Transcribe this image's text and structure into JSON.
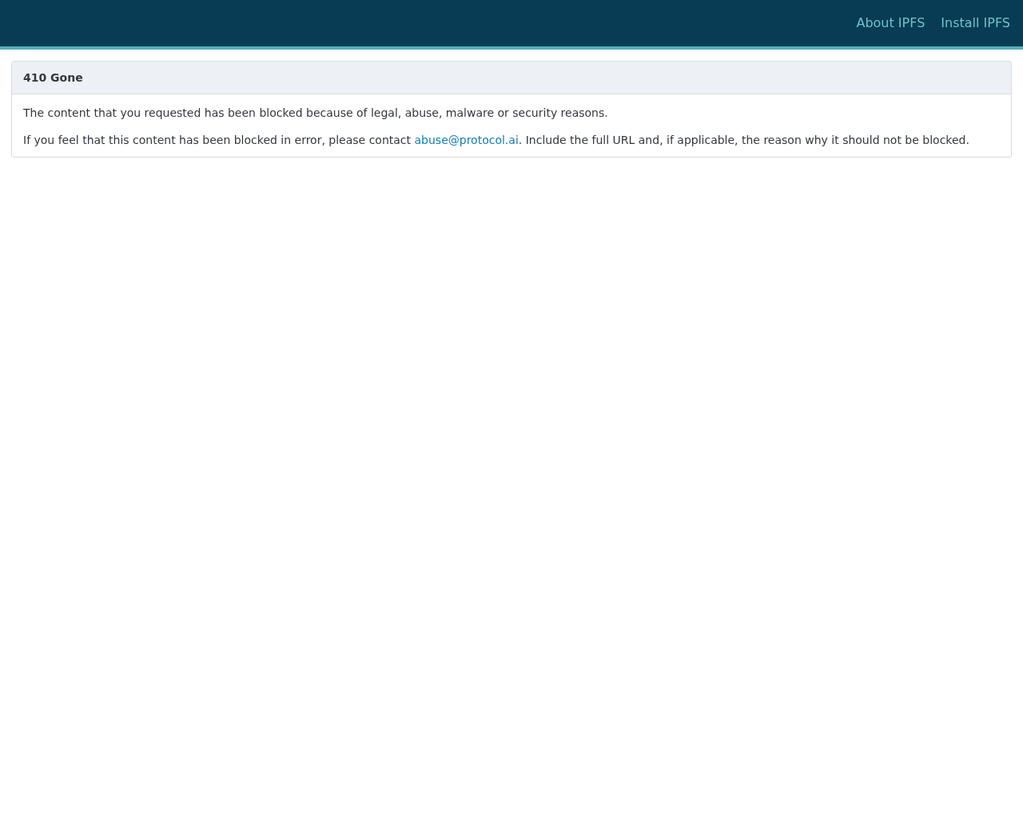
{
  "header": {
    "links": [
      {
        "label": "About IPFS"
      },
      {
        "label": "Install IPFS"
      }
    ]
  },
  "card": {
    "title": "410 Gone",
    "paragraphs": [
      {
        "before": "The content that you requested has been blocked because of legal, abuse, malware or security reasons."
      },
      {
        "before": "If you feel that this content has been blocked in error, please contact ",
        "link": "abuse@protocol.ai",
        "after": ". Include the full URL and, if applicable, the reason why it should not be blocked."
      }
    ]
  }
}
